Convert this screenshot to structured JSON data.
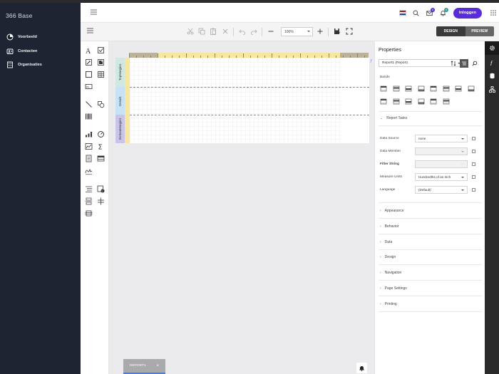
{
  "app": {
    "brand": "366 Base"
  },
  "sidebar": {
    "items": [
      {
        "label": "Voorbeeld",
        "icon": "dashboard-icon"
      },
      {
        "label": "Contacten",
        "icon": "contacts-icon"
      },
      {
        "label": "Organisaties",
        "icon": "building-icon"
      }
    ]
  },
  "header": {
    "login_label": "Inloggen",
    "messages_badge": "0",
    "notifications_badge": "0",
    "language_flag": "NL",
    "flag_colors": [
      "#ae1c28",
      "#ffffff",
      "#21468b"
    ],
    "accent": "#5a2bd9"
  },
  "toolbar": {
    "zoom": "100%",
    "design_label": "DESIGN",
    "preview_label": "PREVIEW"
  },
  "designer": {
    "bands": [
      "TopMargin1",
      "Detail1",
      "BottomMargin1"
    ],
    "band_colors": [
      "#cfe9e2",
      "#c6e2f7",
      "#c9c5ea"
    ],
    "document_tab": "REPORT1"
  },
  "properties": {
    "title": "Properties",
    "selected_object": "Report1 (Report)",
    "bands_label": "Bands",
    "report_tasks_label": "Report Tasks",
    "fields": [
      {
        "label": "Data Source",
        "value": "none"
      },
      {
        "label": "Data Member",
        "value": ""
      },
      {
        "label": "Filter String",
        "value": ""
      },
      {
        "label": "Measure Units",
        "value": "Hundredths of an Inch"
      },
      {
        "label": "Language",
        "value": "(Default)"
      }
    ],
    "sections": [
      "Appearance",
      "Behavior",
      "Data",
      "Design",
      "Navigation",
      "Page Settings",
      "Printing"
    ]
  }
}
